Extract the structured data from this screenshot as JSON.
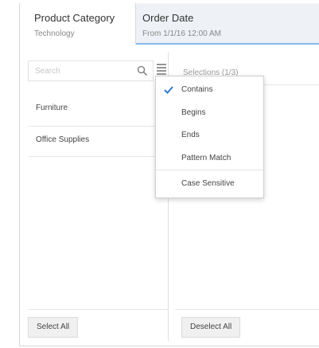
{
  "tabs": [
    {
      "title": "Product Category",
      "value": "Technology"
    },
    {
      "title": "Order Date",
      "value": "From 1/1/16 12:00 AM"
    }
  ],
  "search": {
    "placeholder": "Search"
  },
  "left_list": [
    "Furniture",
    "Office Supplies"
  ],
  "right_header": "Selections (1/3)",
  "dropdown": {
    "items": [
      "Contains",
      "Begins",
      "Ends",
      "Pattern Match",
      "Case Sensitive"
    ],
    "checked": "Contains"
  },
  "buttons": {
    "select_all": "Select All",
    "deselect_all": "Deselect All"
  },
  "colors": {
    "accent": "#2f7bd1",
    "tab_underline": "#88b9e8",
    "inactive_tab_bg": "#eef2f6"
  }
}
